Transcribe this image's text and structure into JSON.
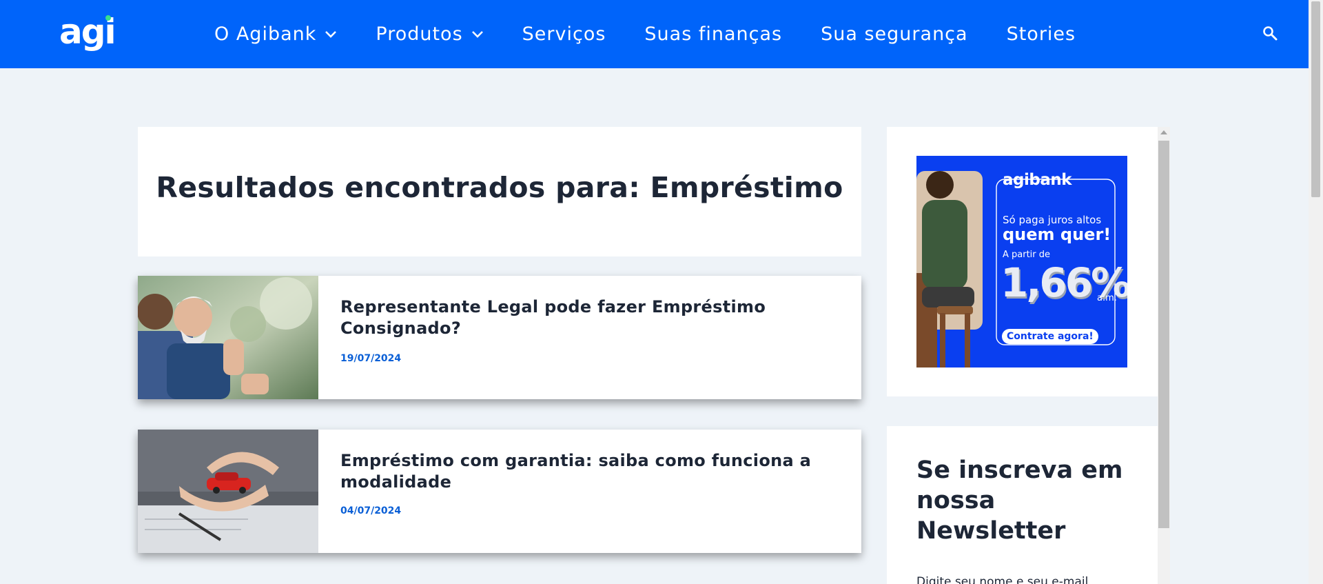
{
  "header": {
    "logo_text": "agi",
    "nav": [
      {
        "label": "O Agibank",
        "has_dropdown": true
      },
      {
        "label": "Produtos",
        "has_dropdown": true
      },
      {
        "label": "Serviços",
        "has_dropdown": false
      },
      {
        "label": "Suas finanças",
        "has_dropdown": false
      },
      {
        "label": "Sua segurança",
        "has_dropdown": false
      },
      {
        "label": "Stories",
        "has_dropdown": false
      }
    ],
    "search_icon": "search-icon"
  },
  "main": {
    "title": "Resultados encontrados para: Empréstimo",
    "articles": [
      {
        "title": "Representante Legal pode fazer Empréstimo Consignado?",
        "date": "19/07/2024"
      },
      {
        "title": "Empréstimo com garantia: saiba como funciona a modalidade",
        "date": "04/07/2024"
      }
    ]
  },
  "sidebar": {
    "ad": {
      "brand": "agibank",
      "line1": "Só paga juros altos",
      "line2": "quem quer!",
      "line3": "A partir de",
      "rate": "1,66%",
      "unit": "a.m.",
      "cta": "Contrate agora!"
    },
    "newsletter": {
      "title": "Se inscreva em nossa Newsletter",
      "text": "Digite seu nome e seu e-mail"
    }
  },
  "colors": {
    "header_bg": "#0064fa",
    "page_bg": "#eef3f8",
    "date_color": "#0a5fd6",
    "ad_bg": "#0a3ff0",
    "heading_text": "#1d2636"
  }
}
